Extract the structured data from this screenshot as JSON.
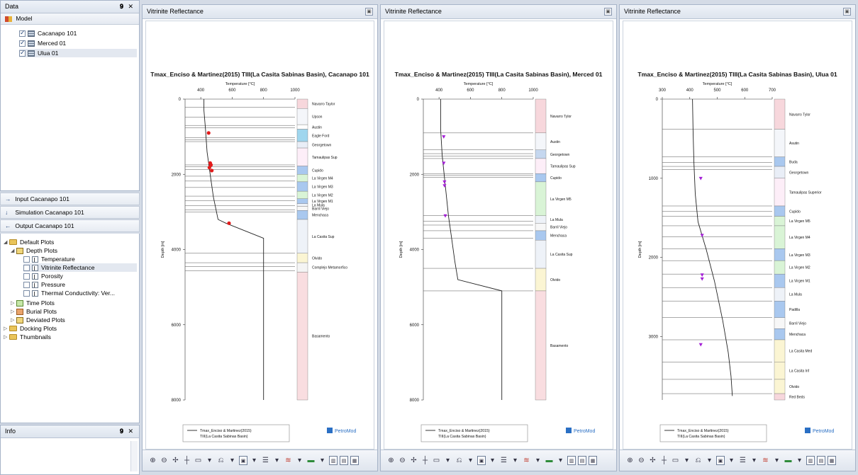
{
  "data_pane": {
    "title": "Data",
    "controls": "𝟗 ✕",
    "model_label": "Model",
    "items": [
      {
        "label": "Cacanapo 101",
        "checked": true
      },
      {
        "label": "Merced 01",
        "checked": true
      },
      {
        "label": "Ulua 01",
        "checked": true
      }
    ]
  },
  "nav": {
    "input": "Input Cacanapo 101",
    "simulation": "Simulation Cacanapo 101",
    "output": "Output Cacanapo 101"
  },
  "tree": {
    "default_plots": "Default Plots",
    "depth_plots": "Depth Plots",
    "depth_items": [
      "Temperature",
      "Vitrinite Reflectance",
      "Porosity",
      "Pressure",
      "Thermal Conductivity: Ver..."
    ],
    "time_plots": "Time Plots",
    "burial_plots": "Burial Plots",
    "deviated_plots": "Deviated Plots",
    "docking_plots": "Docking Plots",
    "thumbnails": "Thumbnails"
  },
  "info_pane": {
    "title": "Info",
    "controls": "𝟗 ✕"
  },
  "chart_data": [
    {
      "type": "line",
      "window_title": "Vitrinite Reflectance",
      "title": "Tmax_Enciso & Martinez(2015) TIII(La Casita Sabinas Basin), Cacanapo 101",
      "xlabel": "Temperature [°C]",
      "ylabel": "Depth [m]",
      "xlim": [
        300,
        1000
      ],
      "xticks": [
        400,
        600,
        800,
        1000
      ],
      "ylim": [
        0,
        8000
      ],
      "yticks": [
        0,
        2000,
        4000,
        6000,
        8000
      ],
      "series": [
        {
          "name": "Tmax_Enciso & Martinez(2015) TIII(La Casita Sabinas Basin)",
          "points": [
            [
              420,
              0
            ],
            [
              420,
              300
            ],
            [
              430,
              800
            ],
            [
              440,
              1400
            ],
            [
              460,
              2000
            ],
            [
              480,
              2600
            ],
            [
              510,
              3200
            ],
            [
              560,
              3300
            ],
            [
              800,
              3700
            ],
            [
              800,
              8000
            ]
          ]
        }
      ],
      "measured": [
        [
          450,
          900
        ],
        [
          460,
          1700
        ],
        [
          465,
          1750
        ],
        [
          455,
          1820
        ],
        [
          470,
          1900
        ],
        [
          580,
          3300
        ]
      ],
      "marker": "dot",
      "marker_color": "#e21b1b",
      "horizons": [
        220,
        480,
        700,
        760,
        1030,
        1080,
        1130,
        1750,
        1800,
        1870,
        2050,
        2180,
        2350,
        2580,
        2700,
        2830,
        2950,
        3000,
        4100,
        4350,
        4450,
        4560
      ],
      "formations": [
        {
          "name": "Navarro Taylor",
          "top": 0,
          "bottom": 250,
          "color": "#f7d7dc"
        },
        {
          "name": "Upson",
          "top": 250,
          "bottom": 680,
          "color": "#f4f6fa"
        },
        {
          "name": "Austin",
          "top": 680,
          "bottom": 800,
          "color": "#ffffff"
        },
        {
          "name": "Eagle Ford",
          "top": 800,
          "bottom": 1130,
          "color": "#9fd6ee"
        },
        {
          "name": "Georgetown",
          "top": 1130,
          "bottom": 1300,
          "color": "#e9eef7"
        },
        {
          "name": "Tamaulipas Sup",
          "top": 1300,
          "bottom": 1780,
          "color": "#fdeef8"
        },
        {
          "name": "Cupido",
          "top": 1780,
          "bottom": 2000,
          "color": "#a9c8ef"
        },
        {
          "name": "La Virgen M4",
          "top": 2000,
          "bottom": 2200,
          "color": "#d9f4d6"
        },
        {
          "name": "La Virgen M3",
          "top": 2200,
          "bottom": 2450,
          "color": "#a9c8ef"
        },
        {
          "name": "La Virgen M2",
          "top": 2450,
          "bottom": 2650,
          "color": "#d9f4d6"
        },
        {
          "name": "La Virgen M1",
          "top": 2650,
          "bottom": 2780,
          "color": "#a9c8ef"
        },
        {
          "name": "La Mula",
          "top": 2780,
          "bottom": 2850,
          "color": "#eef2f8"
        },
        {
          "name": "Barril Viejo",
          "top": 2850,
          "bottom": 2960,
          "color": "#f7f7f7"
        },
        {
          "name": "Menchaca",
          "top": 2960,
          "bottom": 3200,
          "color": "#a9c8ef"
        },
        {
          "name": "La Casita Sup",
          "top": 3200,
          "bottom": 4100,
          "color": "#eef2f8"
        },
        {
          "name": "Olvido",
          "top": 4100,
          "bottom": 4350,
          "color": "#fbf5d3"
        },
        {
          "name": "Complejo Metamorfico",
          "top": 4350,
          "bottom": 4600,
          "color": "#f4f4f4"
        },
        {
          "name": "Basamento",
          "top": 4600,
          "bottom": 8000,
          "color": "#f9dde0"
        }
      ],
      "legend_text": [
        "Tmax_Enciso & Martinez(2015)",
        "TIII(La Casita Sabinas Basin)"
      ],
      "brand": "PetroMod"
    },
    {
      "type": "line",
      "window_title": "Vitrinite Reflectance",
      "title": "Tmax_Enciso & Martinez(2015) TIII(La Casita Sabinas Basin), Merced 01",
      "xlabel": "Temperature [°C]",
      "ylabel": "Depth [m]",
      "xlim": [
        300,
        1000
      ],
      "xticks": [
        400,
        600,
        800,
        1000
      ],
      "ylim": [
        0,
        8000
      ],
      "yticks": [
        0,
        2000,
        4000,
        6000,
        8000
      ],
      "series": [
        {
          "name": "Tmax_Enciso & Martinez(2015) TIII(La Casita Sabinas Basin)",
          "points": [
            [
              410,
              0
            ],
            [
              410,
              800
            ],
            [
              420,
              1500
            ],
            [
              440,
              2300
            ],
            [
              460,
              3100
            ],
            [
              480,
              3700
            ],
            [
              500,
              4300
            ],
            [
              520,
              4800
            ],
            [
              800,
              5100
            ],
            [
              800,
              8000
            ]
          ]
        }
      ],
      "measured": [
        [
          430,
          1000
        ],
        [
          430,
          1700
        ],
        [
          435,
          2200
        ],
        [
          435,
          2300
        ],
        [
          440,
          3100
        ]
      ],
      "marker": "triangle",
      "marker_color": "#a31fd6",
      "horizons": [
        900,
        1350,
        1450,
        1520,
        1580,
        1980,
        2030,
        2080,
        3100,
        3250,
        3350,
        3500,
        3700,
        4500,
        5100
      ],
      "formations": [
        {
          "name": "Navarro Tylor",
          "top": 0,
          "bottom": 900,
          "color": "#f7d7dc"
        },
        {
          "name": "Austin",
          "top": 900,
          "bottom": 1350,
          "color": "#f4f6fa"
        },
        {
          "name": "Georgetown",
          "top": 1350,
          "bottom": 1580,
          "color": "#c5d7ef"
        },
        {
          "name": "Tamaulipas Sup",
          "top": 1580,
          "bottom": 1980,
          "color": "#fdeef8"
        },
        {
          "name": "Cupido",
          "top": 1980,
          "bottom": 2200,
          "color": "#a9c8ef"
        },
        {
          "name": "La Virgen M5",
          "top": 2200,
          "bottom": 3100,
          "color": "#d9f4d6"
        },
        {
          "name": "La Mula",
          "top": 3100,
          "bottom": 3300,
          "color": "#eef2f8"
        },
        {
          "name": "Barril Viejo",
          "top": 3300,
          "bottom": 3500,
          "color": "#f7f7f7"
        },
        {
          "name": "Menchaca",
          "top": 3500,
          "bottom": 3750,
          "color": "#a9c8ef"
        },
        {
          "name": "La Casita Sup",
          "top": 3750,
          "bottom": 4500,
          "color": "#eef2f8"
        },
        {
          "name": "Olvido",
          "top": 4500,
          "bottom": 5100,
          "color": "#fbf5d3"
        },
        {
          "name": "Basamento",
          "top": 5100,
          "bottom": 8000,
          "color": "#f9dde0"
        }
      ],
      "legend_text": [
        "Tmax_Enciso & Martinez(2015)",
        "TIII(La Casita Sabinas Basin)"
      ],
      "brand": "PetroMod"
    },
    {
      "type": "line",
      "window_title": "Vitrinite Reflectance",
      "title": "Tmax_Enciso & Martinez(2015) TIII(La Casita Sabinas Basin), Ulua 01",
      "xlabel": "Temperature [°C]",
      "ylabel": "Depth [m]",
      "xlim": [
        300,
        700
      ],
      "xticks": [
        300,
        400,
        500,
        600,
        700
      ],
      "ylim": [
        0,
        3800
      ],
      "yticks": [
        0,
        1000,
        2000,
        3000
      ],
      "series": [
        {
          "name": "Tmax_Enciso & Martinez(2015) TIII(La Casita Sabinas Basin)",
          "points": [
            [
              410,
              0
            ],
            [
              412,
              400
            ],
            [
              415,
              800
            ],
            [
              420,
              1200
            ],
            [
              430,
              1550
            ],
            [
              460,
              1900
            ],
            [
              490,
              2300
            ],
            [
              520,
              2800
            ],
            [
              540,
              3200
            ],
            [
              550,
              3500
            ],
            [
              555,
              3750
            ]
          ]
        }
      ],
      "measured": [
        [
          440,
          1000
        ],
        [
          445,
          1720
        ],
        [
          445,
          2220
        ],
        [
          445,
          2270
        ],
        [
          440,
          3100
        ]
      ],
      "marker": "triangle",
      "marker_color": "#a31fd6",
      "horizons": [
        380,
        730,
        800,
        850,
        890,
        1350,
        1420,
        1480,
        1600,
        1740,
        1890,
        2040,
        2210,
        2380,
        2550,
        2760,
        3040,
        3320,
        3540,
        3720
      ],
      "formations": [
        {
          "name": "Navarro Tylor",
          "top": 0,
          "bottom": 380,
          "color": "#f7d7dc"
        },
        {
          "name": "Asutin",
          "top": 380,
          "bottom": 730,
          "color": "#f4f6fa"
        },
        {
          "name": "Buda",
          "top": 730,
          "bottom": 850,
          "color": "#a9c8ef"
        },
        {
          "name": "Georgetown",
          "top": 850,
          "bottom": 1000,
          "color": "#e9eef7"
        },
        {
          "name": "Tamaulipas Superior",
          "top": 1000,
          "bottom": 1350,
          "color": "#fdeef8"
        },
        {
          "name": "Cupido",
          "top": 1350,
          "bottom": 1480,
          "color": "#a9c8ef"
        },
        {
          "name": "La Virgen M5",
          "top": 1480,
          "bottom": 1600,
          "color": "#d9f4d6"
        },
        {
          "name": "La Virgen M4",
          "top": 1600,
          "bottom": 1890,
          "color": "#d9f4d6"
        },
        {
          "name": "La Virgen M3",
          "top": 1890,
          "bottom": 2040,
          "color": "#a9c8ef"
        },
        {
          "name": "La Virgen M2",
          "top": 2040,
          "bottom": 2210,
          "color": "#d9f4d6"
        },
        {
          "name": "La Virgen M1",
          "top": 2210,
          "bottom": 2380,
          "color": "#a9c8ef"
        },
        {
          "name": "La Mula",
          "top": 2380,
          "bottom": 2550,
          "color": "#eef2f8"
        },
        {
          "name": "Padilla",
          "top": 2550,
          "bottom": 2760,
          "color": "#a9c8ef"
        },
        {
          "name": "Barril Viejo",
          "top": 2760,
          "bottom": 2900,
          "color": "#f7f7f7"
        },
        {
          "name": "Menchaca",
          "top": 2900,
          "bottom": 3040,
          "color": "#a9c8ef"
        },
        {
          "name": "La Casita Med",
          "top": 3040,
          "bottom": 3320,
          "color": "#fbf5d3"
        },
        {
          "name": "La Casita Inf",
          "top": 3320,
          "bottom": 3540,
          "color": "#fbf5d3"
        },
        {
          "name": "Olvido",
          "top": 3540,
          "bottom": 3720,
          "color": "#fbf5d3"
        },
        {
          "name": "Red Beds",
          "top": 3720,
          "bottom": 3800,
          "color": "#f7d7dc"
        }
      ],
      "legend_text": [
        "Tmax_Enciso & Martinez(2015)",
        "TIII(La Casita Sabinas Basin)"
      ],
      "brand": "PetroMod"
    }
  ],
  "colors": {
    "panel_border": "#a7b4c8",
    "series_line": "#222222"
  },
  "icons": [
    "model-icon",
    "table-icon",
    "folder-icon",
    "plot-icon",
    "zoom-in-icon",
    "zoom-out-icon",
    "pan-icon",
    "crosshair-icon",
    "petromod-logo-icon"
  ]
}
